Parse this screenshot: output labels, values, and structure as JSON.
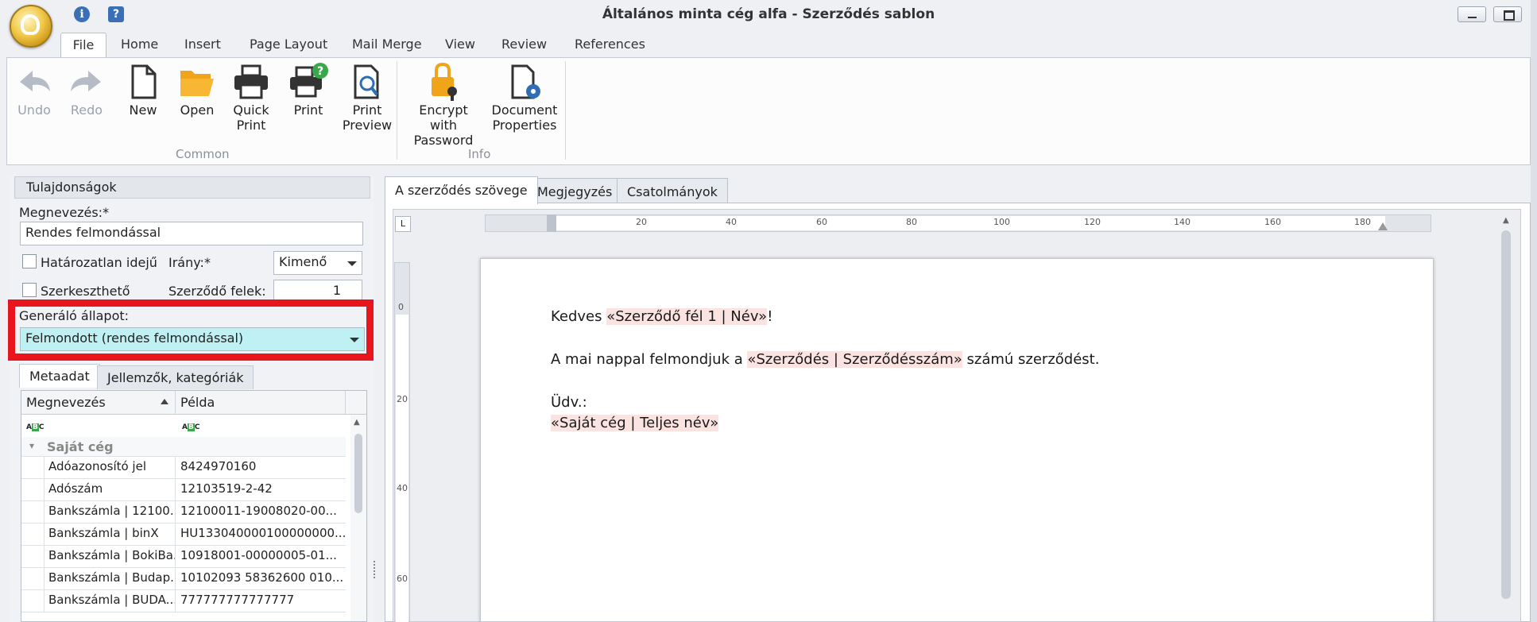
{
  "window": {
    "title": "Általános minta cég alfa - Szerződés sablon"
  },
  "ribbon_tabs": [
    "File",
    "Home",
    "Insert",
    "Page Layout",
    "Mail Merge",
    "View",
    "Review",
    "References"
  ],
  "ribbon": {
    "buttons": {
      "undo": "Undo",
      "redo": "Redo",
      "new": "New",
      "open": "Open",
      "quick_print_1": "Quick",
      "quick_print_2": "Print",
      "print": "Print",
      "print_preview_1": "Print",
      "print_preview_2": "Preview",
      "encrypt_1": "Encrypt with",
      "encrypt_2": "Password",
      "doc_props_1": "Document",
      "doc_props_2": "Properties"
    },
    "groups": {
      "common": "Common",
      "info": "Info"
    },
    "icons": [
      "undo-icon",
      "redo-icon",
      "new-document-icon",
      "open-folder-icon",
      "quick-print-icon",
      "print-icon",
      "print-preview-icon",
      "encrypt-lock-icon",
      "document-properties-icon"
    ]
  },
  "properties": {
    "header": "Tulajdonságok",
    "name_label": "Megnevezés:*",
    "name_value": "Rendes felmondással",
    "indefinite_label": "Határozatlan idejű",
    "direction_label": "Irány:*",
    "direction_value": "Kimenő",
    "editable_label": "Szerkeszthető",
    "parties_label": "Szerződő felek:",
    "parties_value": "1",
    "gen_state_label": "Generáló állapot:",
    "gen_state_value": "Felmondott (rendes felmondással)"
  },
  "meta_tabs": [
    "Metaadat",
    "Jellemzők, kategóriák"
  ],
  "grid": {
    "col_name": "Megnevezés",
    "col_example": "Példa",
    "filter_glyph": "ABC",
    "group": "Saját cég",
    "rows": [
      {
        "name": "Adóazonosító jel",
        "value": "8424970160"
      },
      {
        "name": "Adószám",
        "value": "12103519-2-42"
      },
      {
        "name": "Bankszámla | 12100...",
        "value": "12100011-19008020-00..."
      },
      {
        "name": "Bankszámla | binX",
        "value": "HU133040000100000000..."
      },
      {
        "name": "Bankszámla | BokiBa...",
        "value": "10918001-00000005-01..."
      },
      {
        "name": "Bankszámla | Budap...",
        "value": "10102093 58362600 010..."
      },
      {
        "name": "Bankszámla | BUDA...",
        "value": "777777777777777"
      }
    ]
  },
  "doc_tabs": [
    "A szerződés szövege",
    "Megjegyzés",
    "Csatolmányok"
  ],
  "ruler": {
    "h_labels": [
      "20",
      "40",
      "60",
      "80",
      "100",
      "120",
      "140",
      "160",
      "180"
    ],
    "v_labels": [
      "0",
      "20",
      "40",
      "60"
    ]
  },
  "document": {
    "line1_prefix": "Kedves ",
    "line1_field": "«Szerződő fél 1 | Név»",
    "line1_suffix": "!",
    "line2_prefix": "A mai nappal felmondjuk a ",
    "line2_field": "«Szerződés | Szerződésszám»",
    "line2_suffix": " számú szerződést.",
    "line3": "Üdv.:",
    "line4_field": "«Saját cég | Teljes név»"
  },
  "colors": {
    "highlight_border": "#e8151c",
    "field_background": "#fbe3e1",
    "selected_dropdown": "#bff0f4"
  }
}
